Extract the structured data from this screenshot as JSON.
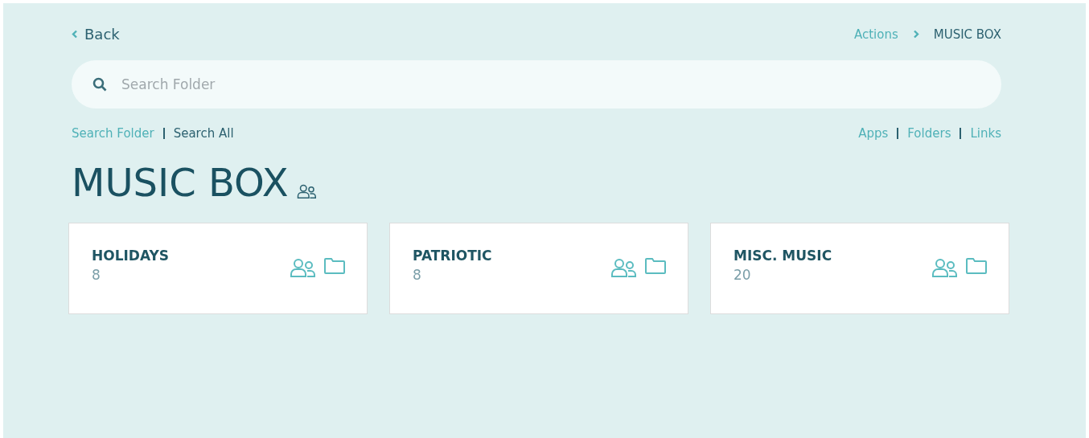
{
  "back": {
    "label": "Back"
  },
  "breadcrumb": [
    {
      "label": "Actions",
      "current": false
    },
    {
      "label": "MUSIC BOX",
      "current": true
    }
  ],
  "search": {
    "placeholder": "Search Folder"
  },
  "search_scope": [
    {
      "label": "Search Folder",
      "selected": false
    },
    {
      "label": "Search All",
      "selected": true
    }
  ],
  "filters": [
    {
      "label": "Apps"
    },
    {
      "label": "Folders"
    },
    {
      "label": "Links"
    }
  ],
  "title": "MUSIC BOX",
  "folders": [
    {
      "name": "HOLIDAYS",
      "count": "8"
    },
    {
      "name": "PATRIOTIC",
      "count": "8"
    },
    {
      "name": "MISC. MUSIC",
      "count": "20"
    }
  ]
}
